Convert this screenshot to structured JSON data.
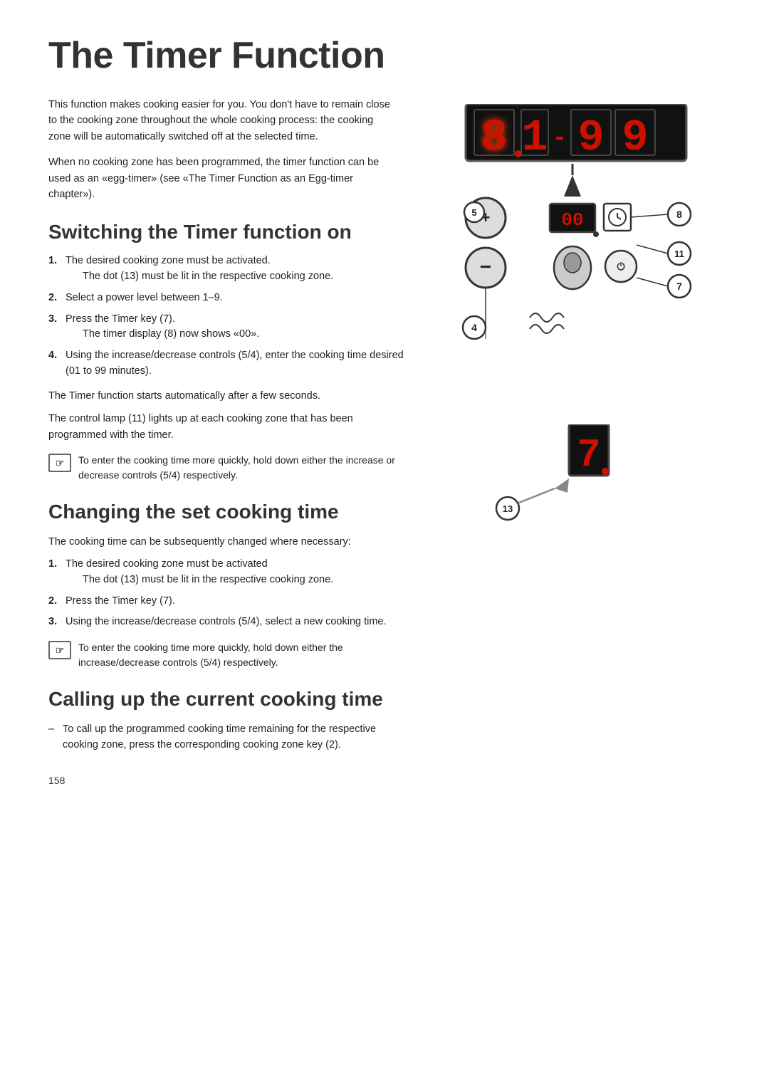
{
  "page": {
    "title": "The Timer Function",
    "page_number": "158"
  },
  "intro": {
    "para1": "This function makes cooking easier for you. You don't have to remain close to the cooking zone throughout the whole cooking process: the cooking zone will be automatically switched off at the selected time.",
    "para2": "When no cooking zone has been programmed, the timer function can be used as an «egg-timer» (see «The Timer Function as an Egg-timer chapter»)."
  },
  "section1": {
    "title": "Switching the Timer function on",
    "steps": [
      {
        "num": "1.",
        "text": "The desired cooking zone must be activated.",
        "sub": "The dot (13) must be lit in the respective cooking zone."
      },
      {
        "num": "2.",
        "text": "Select a power level between 1–9.",
        "sub": ""
      },
      {
        "num": "3.",
        "text": "Press the Timer key (7).",
        "sub": "The timer display (8) now shows «00»."
      },
      {
        "num": "4.",
        "text": "Using the increase/decrease controls (5/4), enter the cooking time desired (01 to 99 minutes).",
        "sub": ""
      }
    ],
    "note1": {
      "text": "The Timer function starts automatically after a few seconds."
    },
    "note2": {
      "text": "The control lamp (11) lights up at each cooking zone that has been programmed with the timer."
    },
    "tip": {
      "text": "To enter the cooking time more quickly, hold down either the increase or decrease controls (5/4) respectively."
    }
  },
  "section2": {
    "title": "Changing the set cooking time",
    "intro": "The cooking time can be subsequently changed where necessary:",
    "steps": [
      {
        "num": "1.",
        "text": "The desired cooking zone must be activated",
        "sub": "The dot (13) must be lit in the respective cooking zone."
      },
      {
        "num": "2.",
        "text": "Press the Timer key (7).",
        "sub": ""
      },
      {
        "num": "3.",
        "text": "Using the increase/decrease controls (5/4), select a new cooking time.",
        "sub": ""
      }
    ],
    "tip": {
      "text": "To enter the cooking time more quickly, hold down either the  increase/decrease controls (5/4) respectively."
    }
  },
  "section3": {
    "title": "Calling up the current cooking time",
    "steps": [
      {
        "text": "To call up the programmed cooking time remaining for the respective cooking zone, press the corresponding cooking zone key (2)."
      }
    ]
  },
  "diagram1": {
    "display_digits": [
      "8",
      "1",
      "-",
      "9",
      "9"
    ],
    "labels": {
      "5": "5",
      "8": "8",
      "11": "11",
      "4": "4",
      "7": "7"
    }
  },
  "diagram2": {
    "label": "13"
  },
  "note_icon": "☞"
}
